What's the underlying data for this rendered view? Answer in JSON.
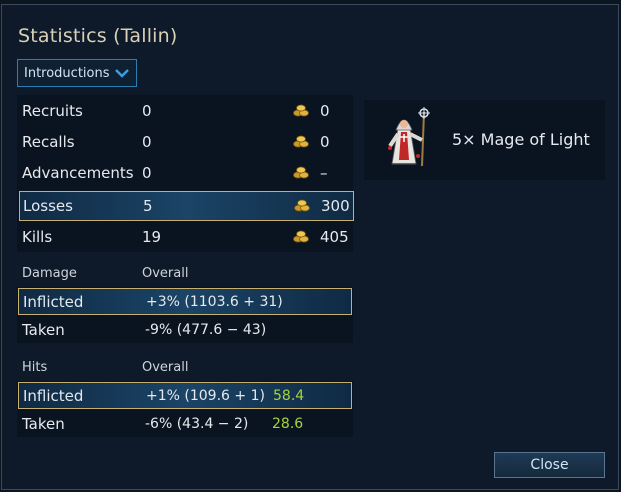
{
  "title": "Statistics (Tallin)",
  "dropdown": {
    "selected": "Introductions"
  },
  "stats": [
    {
      "label": "Recruits",
      "value": "0",
      "gold": "0"
    },
    {
      "label": "Recalls",
      "value": "0",
      "gold": "0"
    },
    {
      "label": "Advancements",
      "value": "0",
      "gold": "–"
    },
    {
      "label": "Losses",
      "value": "5",
      "gold": "300"
    },
    {
      "label": "Kills",
      "value": "19",
      "gold": "405"
    }
  ],
  "damage": {
    "header": "Damage",
    "overall": "Overall",
    "inflicted": {
      "label": "Inflicted",
      "value": "+3% (1103.6 + 31)"
    },
    "taken": {
      "label": "Taken",
      "value": "-9% (477.6 − 43)"
    }
  },
  "hits": {
    "header": "Hits",
    "overall": "Overall",
    "inflicted": {
      "label": "Inflicted",
      "value": "+1% (109.6 + 1)",
      "extra": "58.4"
    },
    "taken": {
      "label": "Taken",
      "value": "-6% (43.4 − 2)",
      "extra": "28.6"
    }
  },
  "unit": {
    "label": "5× Mage of Light"
  },
  "buttons": {
    "close": "Close"
  },
  "colors": {
    "gold_highlight": "#c8b070",
    "accent_green": "#a6d43a",
    "dropdown_border": "#2a7fb0"
  }
}
